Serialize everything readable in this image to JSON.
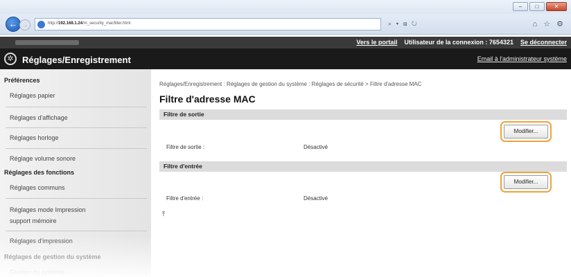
{
  "browser": {
    "url_prefix": "http://",
    "url_host": "192.168.1.24",
    "url_path": "/m_security_macfilter.html",
    "nav_controls": "⌕ ▾ ⊠ ↻",
    "window_buttons": [
      "–",
      "□",
      "✕"
    ],
    "tool_icons": "⌂ ☆ ⚙"
  },
  "topbar": {
    "portal_link": "Vers le portail",
    "login_user_label": "Utilisateur de la connexion :",
    "login_user_value": "7654321",
    "logout_link": "Se déconnecter"
  },
  "header": {
    "title": "Réglages/Enregistrement",
    "admin_mail": "Email à l'administrateur système"
  },
  "sidebar": {
    "preferences_heading": "Préférences",
    "preferences_items": [
      "Réglages papier",
      "Réglages d'affichage",
      "Réglages horloge",
      "Réglage volume sonore"
    ],
    "functions_heading": "Réglages des fonctions",
    "functions_items": [
      "Réglages communs",
      "Réglages mode Impression",
      "support mémoire",
      "Réglages d'impression"
    ],
    "system_heading": "Réglages de gestion du système",
    "system_items": [
      "Gestion du système"
    ]
  },
  "main": {
    "breadcrumb": "Réglages/Enregistrement : Réglages de gestion du système : Réglages de sécurité > Filtre d'adresse MAC",
    "title": "Filtre d'adresse MAC",
    "sections": [
      {
        "heading": "Filtre de sortie",
        "button": "Modifier...",
        "label": "Filtre de sortie :",
        "value": "Désactivé"
      },
      {
        "heading": "Filtre d'entrée",
        "button": "Modifier...",
        "label": "Filtre d'entrée :",
        "value": "Désactivé"
      }
    ]
  }
}
